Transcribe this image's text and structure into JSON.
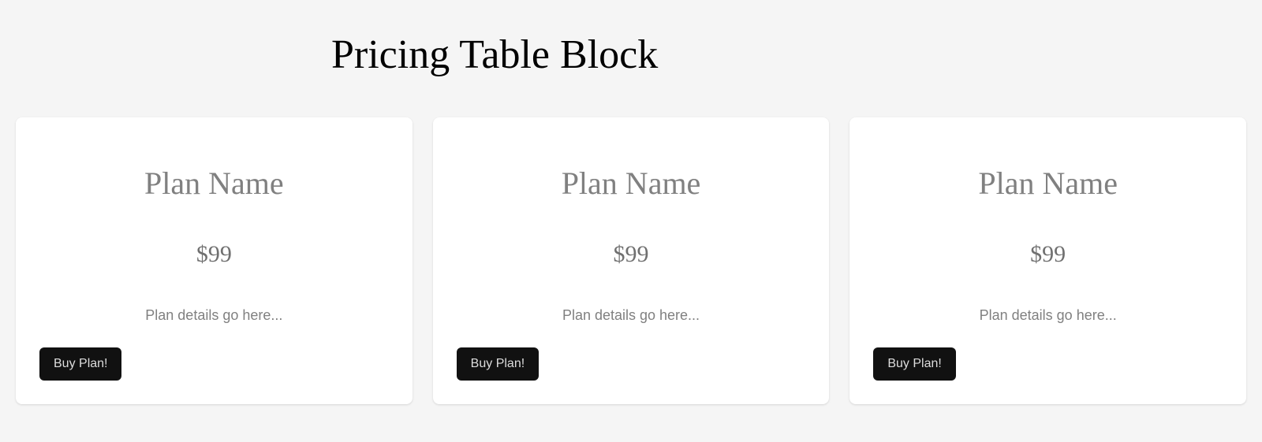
{
  "heading": "Pricing Table Block",
  "plans": [
    {
      "name": "Plan Name",
      "price": "$99",
      "details": "Plan details go here...",
      "button_label": "Buy Plan!"
    },
    {
      "name": "Plan Name",
      "price": "$99",
      "details": "Plan details go here...",
      "button_label": "Buy Plan!"
    },
    {
      "name": "Plan Name",
      "price": "$99",
      "details": "Plan details go here...",
      "button_label": "Buy Plan!"
    }
  ]
}
